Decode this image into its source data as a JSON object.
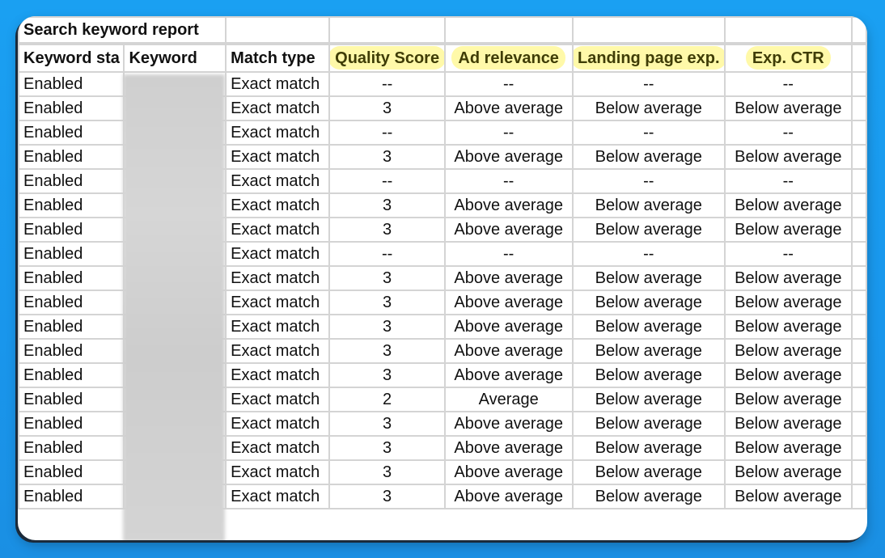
{
  "report": {
    "title": "Search keyword report",
    "columns": [
      "Keyword sta",
      "Keyword",
      "Match type",
      "Quality Score",
      "Ad relevance",
      "Landing page exp.",
      "Exp. CTR"
    ],
    "highlighted_columns": [
      "Quality Score",
      "Ad relevance",
      "Landing page exp.",
      "Exp. CTR"
    ],
    "highlight_color": "#fff78c",
    "keyword_redacted": true,
    "rows": [
      [
        "Enabled",
        "",
        "Exact match",
        "--",
        "--",
        "--",
        "--"
      ],
      [
        "Enabled",
        "",
        "Exact match",
        "3",
        "Above average",
        "Below average",
        "Below average"
      ],
      [
        "Enabled",
        "",
        "Exact match",
        "--",
        "--",
        "--",
        "--"
      ],
      [
        "Enabled",
        "",
        "Exact match",
        "3",
        "Above average",
        "Below average",
        "Below average"
      ],
      [
        "Enabled",
        "",
        "Exact match",
        "--",
        "--",
        "--",
        "--"
      ],
      [
        "Enabled",
        "",
        "Exact match",
        "3",
        "Above average",
        "Below average",
        "Below average"
      ],
      [
        "Enabled",
        "",
        "Exact match",
        "3",
        "Above average",
        "Below average",
        "Below average"
      ],
      [
        "Enabled",
        "",
        "Exact match",
        "--",
        "--",
        "--",
        "--"
      ],
      [
        "Enabled",
        "",
        "Exact match",
        "3",
        "Above average",
        "Below average",
        "Below average"
      ],
      [
        "Enabled",
        "",
        "Exact match",
        "3",
        "Above average",
        "Below average",
        "Below average"
      ],
      [
        "Enabled",
        "",
        "Exact match",
        "3",
        "Above average",
        "Below average",
        "Below average"
      ],
      [
        "Enabled",
        "",
        "Exact match",
        "3",
        "Above average",
        "Below average",
        "Below average"
      ],
      [
        "Enabled",
        "",
        "Exact match",
        "3",
        "Above average",
        "Below average",
        "Below average"
      ],
      [
        "Enabled",
        "",
        "Exact match",
        "2",
        "Average",
        "Below average",
        "Below average"
      ],
      [
        "Enabled",
        "",
        "Exact match",
        "3",
        "Above average",
        "Below average",
        "Below average"
      ],
      [
        "Enabled",
        "",
        "Exact match",
        "3",
        "Above average",
        "Below average",
        "Below average"
      ],
      [
        "Enabled",
        "",
        "Exact match",
        "3",
        "Above average",
        "Below average",
        "Below average"
      ],
      [
        "Enabled",
        "",
        "Exact match",
        "3",
        "Above average",
        "Below average",
        "Below average"
      ]
    ]
  },
  "colors": {
    "background": "#1aa0f2",
    "grid": "#d4d4d4",
    "highlight_text": "#3f3d06"
  }
}
